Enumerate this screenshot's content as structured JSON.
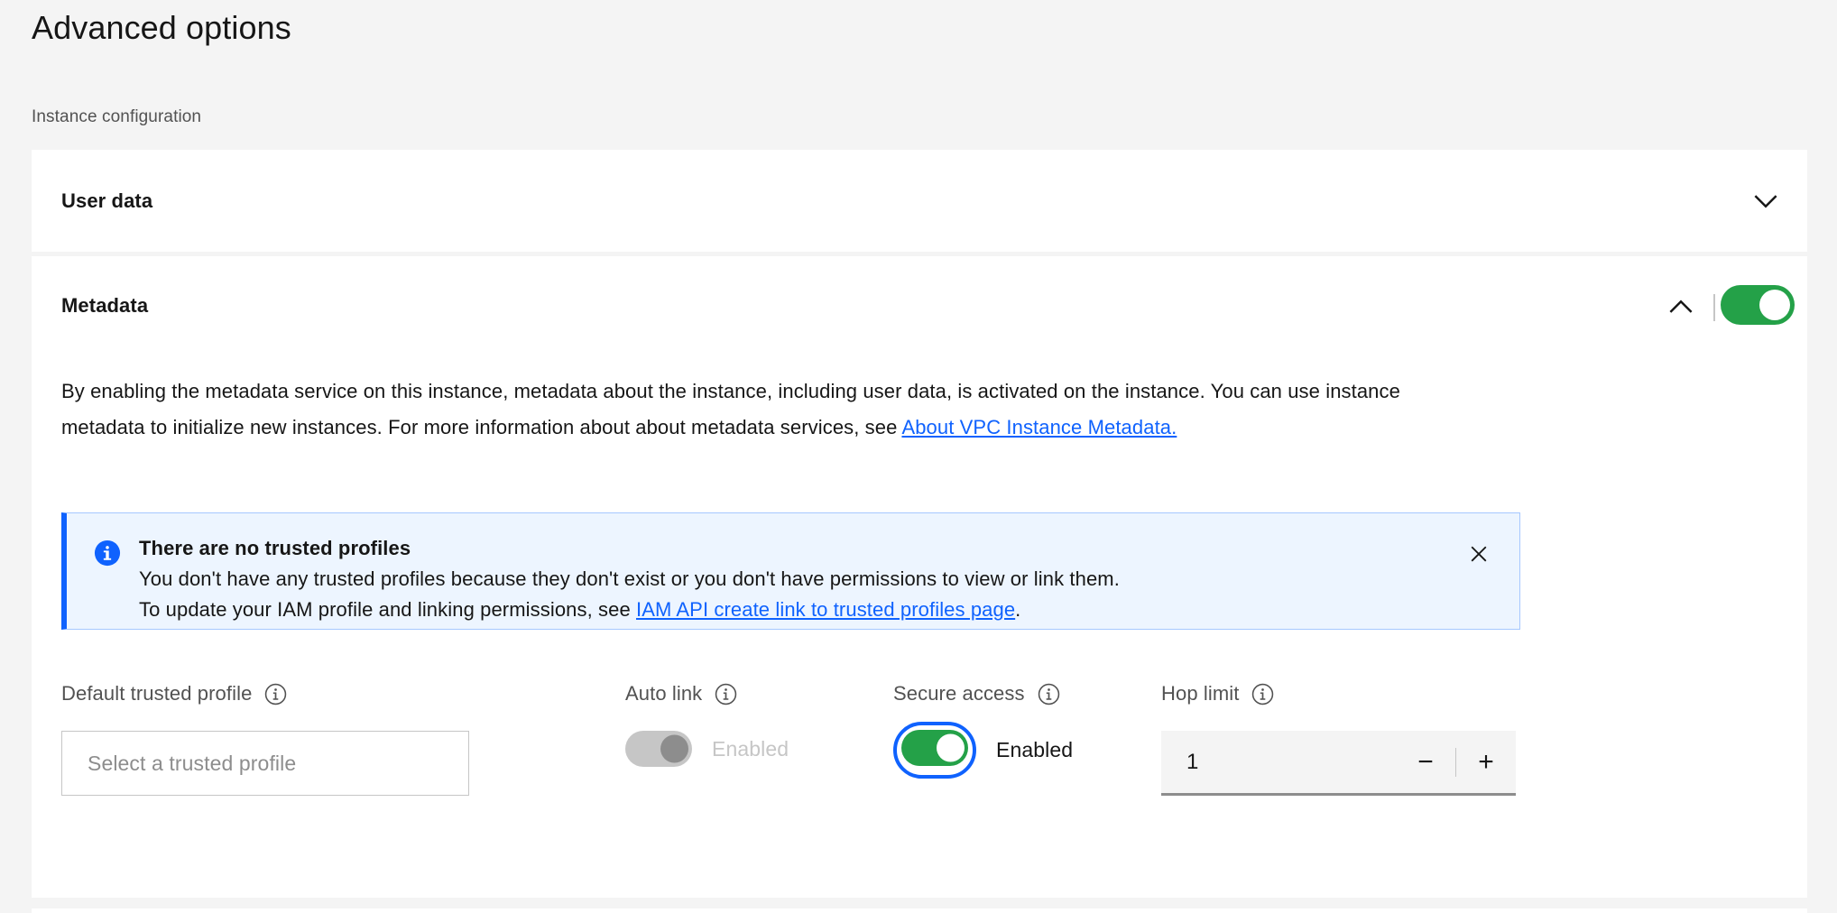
{
  "header": {
    "title": "Advanced options",
    "section_label": "Instance configuration"
  },
  "user_data_section": {
    "title": "User data",
    "expand_icon": "chevron-down-icon",
    "expanded": false
  },
  "metadata_section": {
    "title": "Metadata",
    "collapse_icon": "chevron-up-icon",
    "expanded": true,
    "toggle": {
      "state": "on",
      "color": "#24a148"
    },
    "description": {
      "part1": "By enabling the metadata service on this instance, metadata about the instance, including user data, is activated on the instance. You can use instance metadata to initialize new instances. For more information about about metadata services, see ",
      "link_text": "About VPC Instance Metadata.",
      "link_color": "#0f62fe"
    },
    "notification": {
      "icon": "information-filled-icon",
      "icon_color": "#0f62fe",
      "background": "#edf5ff",
      "border_color": "#a6c8ff",
      "title": "There are no trusted profiles",
      "body_line1": "You don't have any trusted profiles because they don't exist or you don't have permissions to view or link them.",
      "body_line2_prefix": "To update your IAM profile and linking permissions, see ",
      "body_link_text": "IAM API create link to trusted profiles page",
      "body_line2_suffix": ".",
      "close_icon": "close-icon"
    },
    "fields": {
      "default_trusted_profile": {
        "label": "Default trusted profile",
        "info_icon": "information-icon",
        "placeholder": "Select a trusted profile",
        "value": ""
      },
      "auto_link": {
        "label": "Auto link",
        "info_icon": "information-icon",
        "toggle_state": "off",
        "toggle_disabled": true,
        "state_text": "Enabled"
      },
      "secure_access": {
        "label": "Secure access",
        "info_icon": "information-icon",
        "toggle_state": "on",
        "focused": true,
        "focus_color": "#0f62fe",
        "state_text": "Enabled"
      },
      "hop_limit": {
        "label": "Hop limit",
        "info_icon": "information-icon",
        "value": "1",
        "decrement_label": "−",
        "increment_label": "+"
      }
    }
  }
}
